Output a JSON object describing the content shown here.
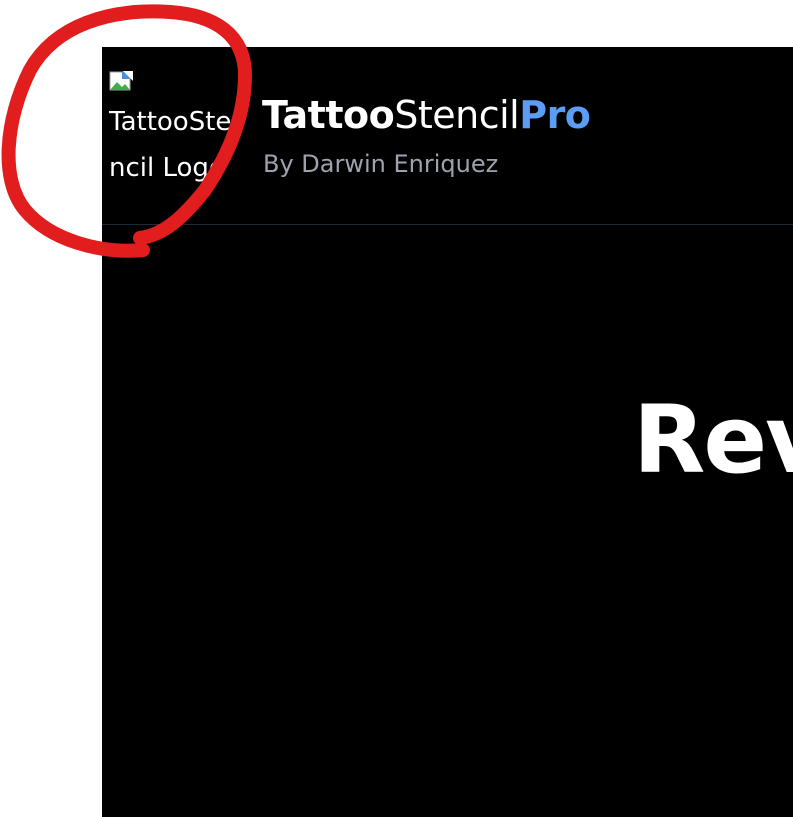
{
  "header": {
    "logo_alt": "TattooStencil Logo",
    "brand": {
      "part1": "Tattoo",
      "part2": "Stencil",
      "part3": "Pro"
    },
    "subtitle": "By Darwin Enriquez"
  },
  "hero": {
    "heading_visible": "Rev"
  },
  "colors": {
    "background": "#000000",
    "accent": "#5b9cf5",
    "subtitle": "#9ca3af",
    "annotation": "#e11d1d"
  },
  "icons": {
    "broken_image": "broken-image-icon"
  }
}
